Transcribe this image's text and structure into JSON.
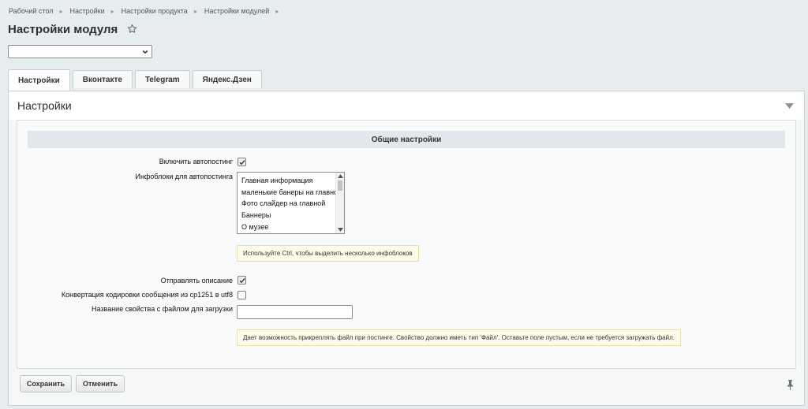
{
  "breadcrumb": [
    "Рабочий стол",
    "Настройки",
    "Настройки продукта",
    "Настройки модулей"
  ],
  "page_title": "Настройки модуля",
  "site_select": {
    "value": ""
  },
  "tabs": [
    {
      "label": "Настройки",
      "active": true
    },
    {
      "label": "Вконтакте",
      "active": false
    },
    {
      "label": "Telegram",
      "active": false
    },
    {
      "label": "Яндекс.Дзен",
      "active": false
    }
  ],
  "panel": {
    "title": "Настройки",
    "section_title": "Общие настройки",
    "fields": {
      "autopost_label": "Включить автопостинг",
      "autopost_checked": true,
      "iblocks_label": "Инфоблоки для автопостинга",
      "iblocks_options": [
        "Главная информация",
        "маленькие банеры на главной",
        "Фото слайдер на главной",
        "Баннеры",
        "О музее"
      ],
      "iblocks_hint": "Используйте Ctrl, чтобы выделить несколько инфоблоков",
      "send_desc_label": "Отправлять описание",
      "send_desc_checked": true,
      "convert_label": "Конвертация кодировки сообщения из cp1251 в utf8",
      "convert_checked": false,
      "file_prop_label": "Название свойства с файлом для загрузки",
      "file_prop_value": "",
      "file_prop_hint": "Дает возможность прикреплять файл при постинге. Свойство должно иметь тип 'Файл'. Оставьте поле пустым, если не требуется загружать файл."
    }
  },
  "buttons": {
    "save": "Сохранить",
    "cancel": "Отменить"
  },
  "colors": {
    "background": "#e7ecee",
    "panel": "#f6f8f8",
    "section_header": "#e1e7ea",
    "hint_bg": "#fefce8"
  },
  "icons": [
    "star-icon",
    "chevron-down-icon",
    "collapse-arrow-icon",
    "checkmark-icon",
    "pin-icon"
  ]
}
